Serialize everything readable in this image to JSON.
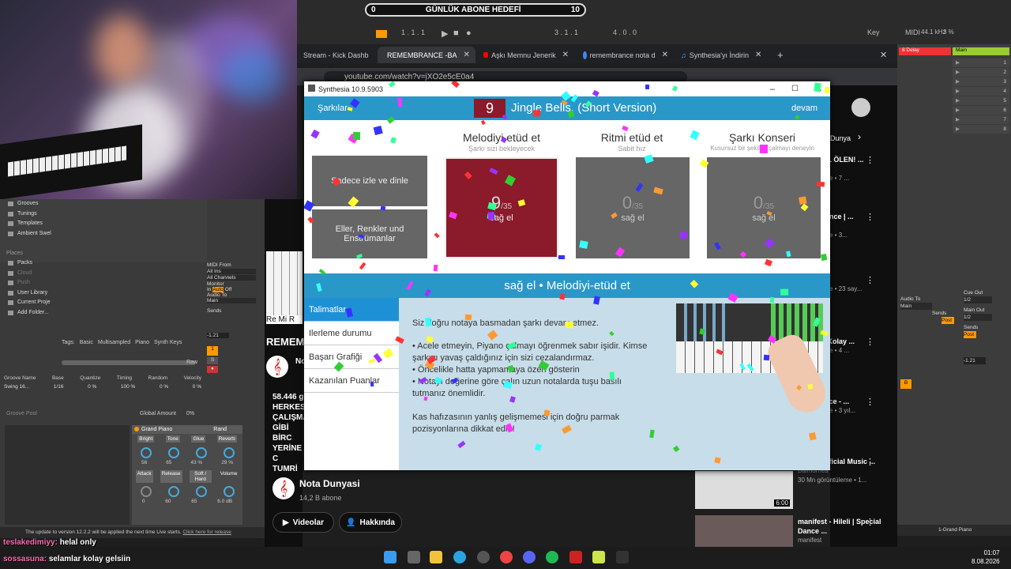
{
  "goal": {
    "start": "0",
    "label": "GÜNLÜK ABONE HEDEFİ",
    "end": "10"
  },
  "ableton": {
    "top": {
      "bars1": "1 . 1 . 1",
      "bars2": "3 . 1 . 1",
      "bars3": "4 . 0 . 0",
      "key": "Key",
      "midi": "MIDI",
      "rate": "44.1 kHz",
      "cpu": "3 %"
    },
    "sidebar": [
      "Grooves",
      "Tunings",
      "Templates",
      "Ambient Swel"
    ],
    "places_label": "Places",
    "places": [
      "Packs",
      "Cloud",
      "Push",
      "User Library",
      "Current Proje",
      "Add Folder..."
    ],
    "tags": {
      "label": "Tags:",
      "items": [
        "Basic",
        "Multisampled",
        "Piano",
        "Synth Keys"
      ],
      "raw": "Raw"
    },
    "groove": {
      "headers": [
        "Groove Name",
        "Base",
        "Quantize",
        "Timing",
        "Random",
        "Velocity"
      ],
      "row": [
        "Swing 16...",
        "1/16",
        "0 %",
        "100 %",
        "0 %",
        "0 %"
      ],
      "pool": "Groove Pool",
      "global_amount": "Global Amount",
      "global_val": "0%"
    },
    "device": {
      "name": "Grand Piano",
      "rand": "Rand",
      "knobs1": [
        "Bright",
        "Tone",
        "Glue",
        "Reverb"
      ],
      "vals1": [
        "56",
        "65",
        "43 %",
        "29 %"
      ],
      "knobs2": [
        "Attack",
        "Release",
        "Soft / Hard",
        "Volume"
      ],
      "vals2": [
        "0",
        "60",
        "65",
        "6.0 dB"
      ]
    },
    "midi": {
      "from": "MIDI From",
      "all_ins": "All Ins",
      "all_ch": "All Channels",
      "monitor": "Monitor",
      "in": "In",
      "auto": "Auto",
      "off": "Off",
      "audio_to": "Audio To",
      "main": "Main",
      "sends": "Sends",
      "vol": "-1.21"
    },
    "right": {
      "track1": "8 Delay",
      "track2": "Main",
      "cue_out": "Cue Out",
      "cue_val": "1/2",
      "main_out": "Main Out",
      "main_val": "1/2",
      "audio_to": "Audio To",
      "main": "Main",
      "sends": "Sends",
      "post": "Post",
      "vol": "-1.21",
      "grand": "1-Grand Piano",
      "rows": [
        "1",
        "2",
        "3",
        "4",
        "5",
        "6",
        "7",
        "8"
      ]
    },
    "update": "The update to version 12.2.2 will be applied the next time Live starts.",
    "update_link": "Click here for release"
  },
  "browser": {
    "tabs": [
      "Stream - Kick Dashb",
      "REMEMBRANCE -BA",
      "Aşkı Memnu Jenerik",
      "remembrance nota d",
      "Synthesia'yı İndirin"
    ],
    "url": "youtube.com/watch?v=jXO2e5cE0a4"
  },
  "youtube": {
    "remem": "REMEM",
    "channel": "Nota Dunyasi",
    "subs": "14,2 B abone",
    "videos_btn": "Videolar",
    "about_btn": "Hakkında",
    "views": "58.446 g",
    "desc": [
      "HERKESİ",
      "ÇALIŞMA",
      "GİBİ BİRC",
      "YERİNE C",
      "TUMRİ"
    ],
    "re_mi": "Re Mi R",
    "no": "No",
    "right_items": [
      {
        "title": "AK DEĞİL ÖLEN! ...",
        "meta": "oglu",
        "meta2": "görüntüleme • 7 ..."
      },
      {
        "title": "Einaudi ance | ...",
        "meta": "nze",
        "meta2": "görüntüleme • 3..."
      },
      {
        "title": "ase - nce",
        "meta": "",
        "meta2": "görüntüleme • 23 say..."
      },
      {
        "title": "ar - Film Kolay ...",
        "meta": "",
        "meta2": "görüntüleme • 4 ..."
      },
      {
        "title": "nce - nance - ...",
        "meta": "",
        "meta2": "görüntüleme • 3 yıl..."
      },
      {
        "title": "rance (Official Music ...",
        "meta": "Balmorhea",
        "meta2": "30 Mn görüntüleme • 1..."
      },
      {
        "title": "manifest - Hileli | Special Dance ...",
        "meta": "manifest",
        "meta2": ""
      }
    ],
    "duration": "6:00",
    "dunya": "Dunya"
  },
  "synthesia": {
    "title": "Synthesia 10.9.5903",
    "songs_btn": "Şarkılar",
    "song_num": "9",
    "song_name": "Jingle Bells, (Short Version)",
    "continue_btn": "devam",
    "modes": [
      {
        "title": "Melodiyi etüd et",
        "sub": "Şarkı sizi bekleyecek"
      },
      {
        "title": "Ritmi etüd et",
        "sub": "Sabit hız"
      },
      {
        "title": "Şarkı Konseri",
        "sub": "Kusursuz bir şekilde çalmayı deneyin"
      }
    ],
    "watch_btn": "Sadece izle ve dinle",
    "hands_btn": "Eller, Renkler und Enstrümanlar",
    "cards": [
      {
        "num": "9",
        "den": "/35",
        "label": "sağ el"
      },
      {
        "num": "0",
        "den": "/35",
        "label": "sağ el"
      },
      {
        "num": "0",
        "den": "/35",
        "label": "sağ el"
      }
    ],
    "bar": "sağ el • Melodiyi-etüd et",
    "nav": [
      "Talimatlar",
      "Ilerleme durumu",
      "Başarı Grafiği",
      "Kazanılan Puanlar"
    ],
    "instructions": {
      "line1": "Siz doğru notaya basmadan şarkı devam etmez.",
      "b1": "• Acele etmeyin, Piyano çalmayı öğrenmek sabır işidir. Kimse şarkıyı yavaş çaldığınız için sizi cezalandırmaz.",
      "b2": "• Öncelikle hatta yapmamaya özen gösterin",
      "b3": "• Notayı değerine göre çalın uzun notalarda tuşu basılı tutmanız önemlidir.",
      "last": "Kas hafızasının yanlış gelişmemesi için doğru parmak pozisyonlarına dikkat edin!"
    }
  },
  "chat": [
    {
      "user": "teslakedimiyy:",
      "msg": "helal only",
      "color": "#ff69b4"
    },
    {
      "user": "sossasuna:",
      "msg": "selamlar kolay gelsiin",
      "color": "#ff69b4"
    }
  ],
  "clock": {
    "time": "01:07",
    "date": "8.08.2026"
  },
  "colors": {
    "synth_blue": "#2a97c9",
    "card_red": "#8b1a2a",
    "tab_red": "#ff0000"
  }
}
